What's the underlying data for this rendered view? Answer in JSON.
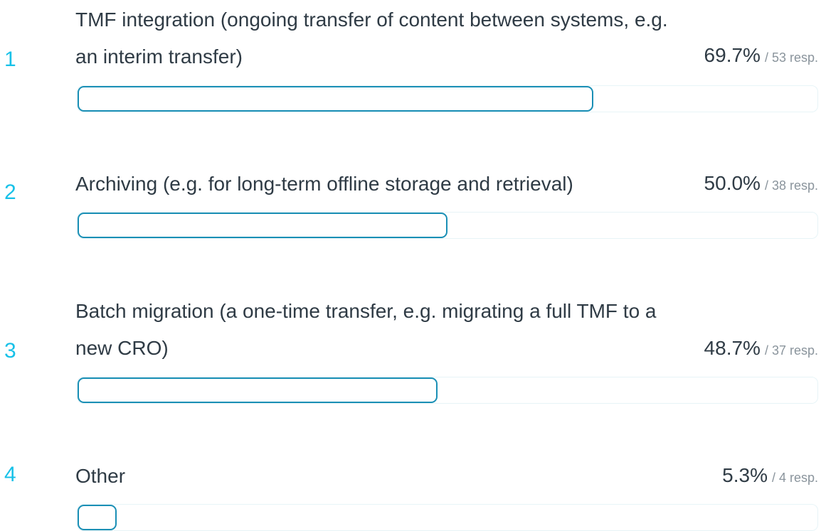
{
  "chart_data": {
    "type": "bar",
    "orientation": "horizontal",
    "xlim": [
      0,
      100
    ],
    "items": [
      {
        "rank": "1",
        "label": "TMF integration (ongoing transfer of content between systems, e.g. an interim transfer)",
        "percent_text": "69.7%",
        "responses_text": "/ 53 resp.",
        "value": 69.7,
        "responses": 53
      },
      {
        "rank": "2",
        "label": "Archiving (e.g. for long-term offline storage and retrieval)",
        "percent_text": "50.0%",
        "responses_text": "/ 38 resp.",
        "value": 50.0,
        "responses": 38
      },
      {
        "rank": "3",
        "label": "Batch migration (a one-time transfer, e.g. migrating a full TMF to a new CRO)",
        "percent_text": "48.7%",
        "responses_text": "/ 37 resp.",
        "value": 48.7,
        "responses": 37
      },
      {
        "rank": "4",
        "label": "Other",
        "percent_text": "5.3%",
        "responses_text": "/ 4 resp.",
        "value": 5.3,
        "responses": 4
      }
    ]
  },
  "colors": {
    "rank": "#17c1e8",
    "text": "#2f3b45",
    "muted": "#8a949c",
    "bar_outline": "#1a8fb5",
    "track_border": "#e7f4f7"
  }
}
